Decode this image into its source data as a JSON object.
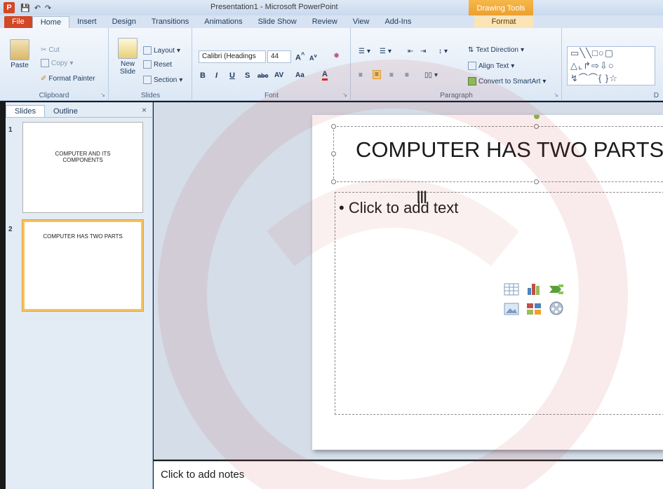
{
  "window": {
    "title": "Presentation1 - Microsoft PowerPoint",
    "app_icon": "P",
    "contextual_tab_group": "Drawing Tools"
  },
  "qat": {
    "save_icon": "save-icon",
    "undo_icon": "undo-icon",
    "redo_icon": "redo-icon"
  },
  "tabs": [
    "File",
    "Home",
    "Insert",
    "Design",
    "Transitions",
    "Animations",
    "Slide Show",
    "Review",
    "View",
    "Add-Ins",
    "Format"
  ],
  "ribbon": {
    "clipboard": {
      "label": "Clipboard",
      "paste": "Paste",
      "cut": "Cut",
      "copy": "Copy",
      "format_painter": "Format Painter"
    },
    "slides": {
      "label": "Slides",
      "new_slide": "New Slide",
      "layout": "Layout",
      "reset": "Reset",
      "section": "Section"
    },
    "font": {
      "label": "Font",
      "font_name": "Calibri (Headings",
      "font_size": "44",
      "bold": "B",
      "italic": "I",
      "underline": "U",
      "strike": "S",
      "shadow": "abc",
      "spacing": "AV",
      "case": "Aa",
      "color": "A"
    },
    "paragraph": {
      "label": "Paragraph",
      "text_direction": "Text Direction",
      "align_text": "Align Text",
      "convert_smartart": "Convert to SmartArt"
    },
    "drawing": {
      "label": "D"
    }
  },
  "left_pane": {
    "tabs": [
      "Slides",
      "Outline"
    ],
    "close": "×",
    "slides": [
      {
        "number": "1",
        "title": "COMPUTER AND ITS COMPONENTS"
      },
      {
        "number": "2",
        "title": "COMPUTER HAS TWO PARTS"
      }
    ]
  },
  "slide": {
    "title": "COMPUTER HAS TWO PARTS",
    "bullet": "•",
    "body_placeholder": "Click to add text"
  },
  "notes": {
    "placeholder": "Click to add notes"
  },
  "colors": {
    "accent": "#d24726",
    "drawing_tools": "#f0a030",
    "selection": "#f6c25c"
  }
}
